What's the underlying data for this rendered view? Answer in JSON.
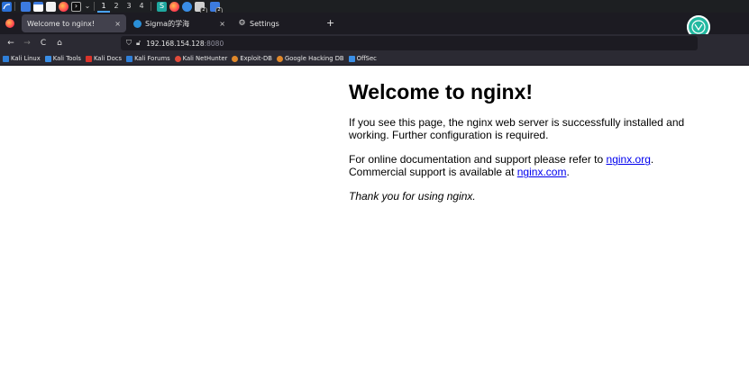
{
  "taskbar": {
    "workspaces": [
      "1",
      "2",
      "3",
      "4"
    ],
    "active_workspace": "1",
    "badges": [
      "2",
      "2"
    ],
    "icons": [
      "kali-menu-icon",
      "desktop-icon",
      "files-icon",
      "text-editor-icon",
      "firefox-icon",
      "terminal-icon",
      "chevron-down-icon"
    ]
  },
  "tabs": [
    {
      "title": "Welcome to nginx!",
      "close": "×",
      "active": true
    },
    {
      "title": "Sigma的学海",
      "close": "×",
      "active": false
    },
    {
      "title": "Settings",
      "close": "",
      "active": false
    }
  ],
  "new_tab_label": "+",
  "nav": {
    "back": "←",
    "forward": "→",
    "reload": "C",
    "home": "⌂"
  },
  "url": {
    "host": "192.168.154.128",
    "port": ":8080"
  },
  "bookmarks": [
    {
      "label": "Kali Linux",
      "color": "#2f7fd8"
    },
    {
      "label": "Kali Tools",
      "color": "#3a8ee6"
    },
    {
      "label": "Kali Docs",
      "color": "#d9342b"
    },
    {
      "label": "Kali Forums",
      "color": "#2f7fd8"
    },
    {
      "label": "Kali NetHunter",
      "color": "#e04a3a"
    },
    {
      "label": "Exploit-DB",
      "color": "#e0882a"
    },
    {
      "label": "Google Hacking DB",
      "color": "#e0882a"
    },
    {
      "label": "OffSec",
      "color": "#3a8ee6"
    }
  ],
  "page": {
    "heading": "Welcome to nginx!",
    "p1": "If you see this page, the nginx web server is successfully installed and working. Further configuration is required.",
    "p2_prefix": "For online documentation and support please refer to ",
    "link1": "nginx.org",
    "p2_middle": ".",
    "p2_line2": "Commercial support is available at ",
    "link2": "nginx.com",
    "p2_suffix": ".",
    "p3": "Thank you for using nginx."
  },
  "colors": {
    "taskbar_bg": "#1d1f22",
    "tabbar_bg": "#1c1b22",
    "toolbar_bg": "#2b2a33",
    "link": "#0000ee"
  }
}
